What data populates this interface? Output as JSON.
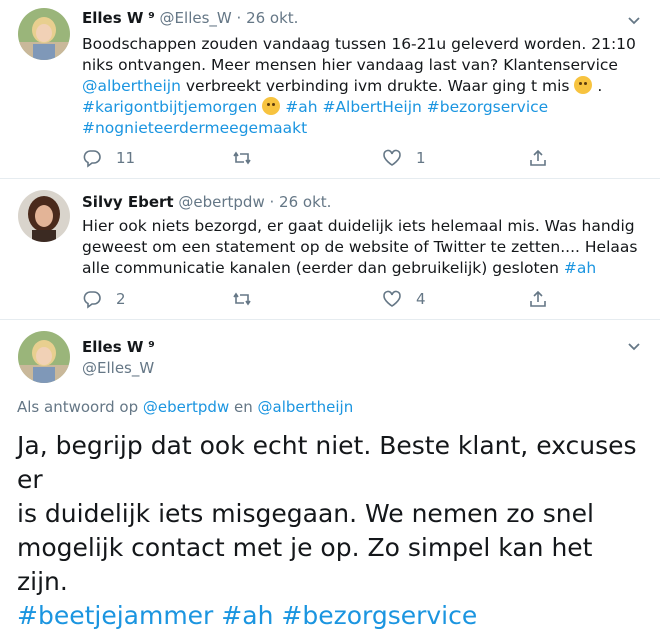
{
  "tweets": [
    {
      "name": "Elles W",
      "name_mark": "⁹",
      "handle": "@Elles_W",
      "date": "26 okt.",
      "text_line1": "Boodschappen zouden vandaag tussen 16-21u geleverd worden. 21:10",
      "text_line2": "niks ontvangen. Meer mensen hier vandaag last van? Klantenservice",
      "mention": "@albertheijn",
      "text_line3": " verbreekt verbinding ivm drukte. Waar ging t mis ",
      "emoji1": "thinking-face",
      "text_line3_end": " .",
      "tag1": "#karigontbijtjemorgen",
      "emoji2": "grinning-sweat-face",
      "tag2": "#ah",
      "tag3": "#AlbertHeijn",
      "tag4": "#bezorgservice",
      "tag5": "#nognieteerdermeegemaakt",
      "replies": "11",
      "retweets": "",
      "likes": "1"
    },
    {
      "name": "Silvy Ebert",
      "handle": "@ebertpdw",
      "date": "26 okt.",
      "text_line1": "Hier ook niets bezorgd, er gaat duidelijk iets helemaal mis. Was handig",
      "text_line2": "geweest om een statement op de website of Twitter te zetten.... Helaas",
      "text_line3": "alle communicatie kanalen (eerder dan gebruikelijk) gesloten ",
      "tag1": "#ah",
      "replies": "2",
      "retweets": "",
      "likes": "4"
    }
  ],
  "main_tweet": {
    "name": "Elles W",
    "name_mark": "⁹",
    "handle": "@Elles_W",
    "reply_prefix": "Als antwoord op ",
    "reply_to1": "@ebertpdw",
    "reply_join": " en ",
    "reply_to2": "@albertheijn",
    "line1": "Ja, begrijp dat ook echt niet. Beste klant, excuses er",
    "line2": "is duidelijk iets misgegaan. We nemen zo snel",
    "line3": "mogelijk contact met je op. Zo simpel kan het zijn.",
    "tag1": "#beetjejammer",
    "tag2": "#ah",
    "tag3": "#bezorgservice"
  },
  "colors": {
    "link": "#1b95e0",
    "muted": "#657786",
    "text": "#14171a"
  },
  "icons": [
    "reply-icon",
    "retweet-icon",
    "like-icon",
    "share-icon",
    "caret-down-icon"
  ]
}
